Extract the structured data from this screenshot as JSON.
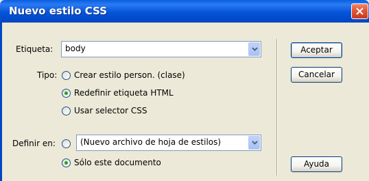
{
  "window": {
    "title": "Nuevo estilo CSS"
  },
  "etiqueta": {
    "label": "Etiqueta:",
    "value": "body"
  },
  "tipo": {
    "label": "Tipo:",
    "options": [
      {
        "label": "Crear estilo person. (clase)",
        "selected": false
      },
      {
        "label": "Redefinir etiqueta HTML",
        "selected": true
      },
      {
        "label": "Usar selector CSS",
        "selected": false
      }
    ]
  },
  "definir": {
    "label": "Definir en:",
    "combo_value": "(Nuevo archivo de hoja de estilos)",
    "options": [
      {
        "label": "",
        "selected": false
      },
      {
        "label": "Sólo este documento",
        "selected": true
      }
    ]
  },
  "buttons": {
    "accept": "Aceptar",
    "cancel": "Cancelar",
    "help": "Ayuda"
  }
}
